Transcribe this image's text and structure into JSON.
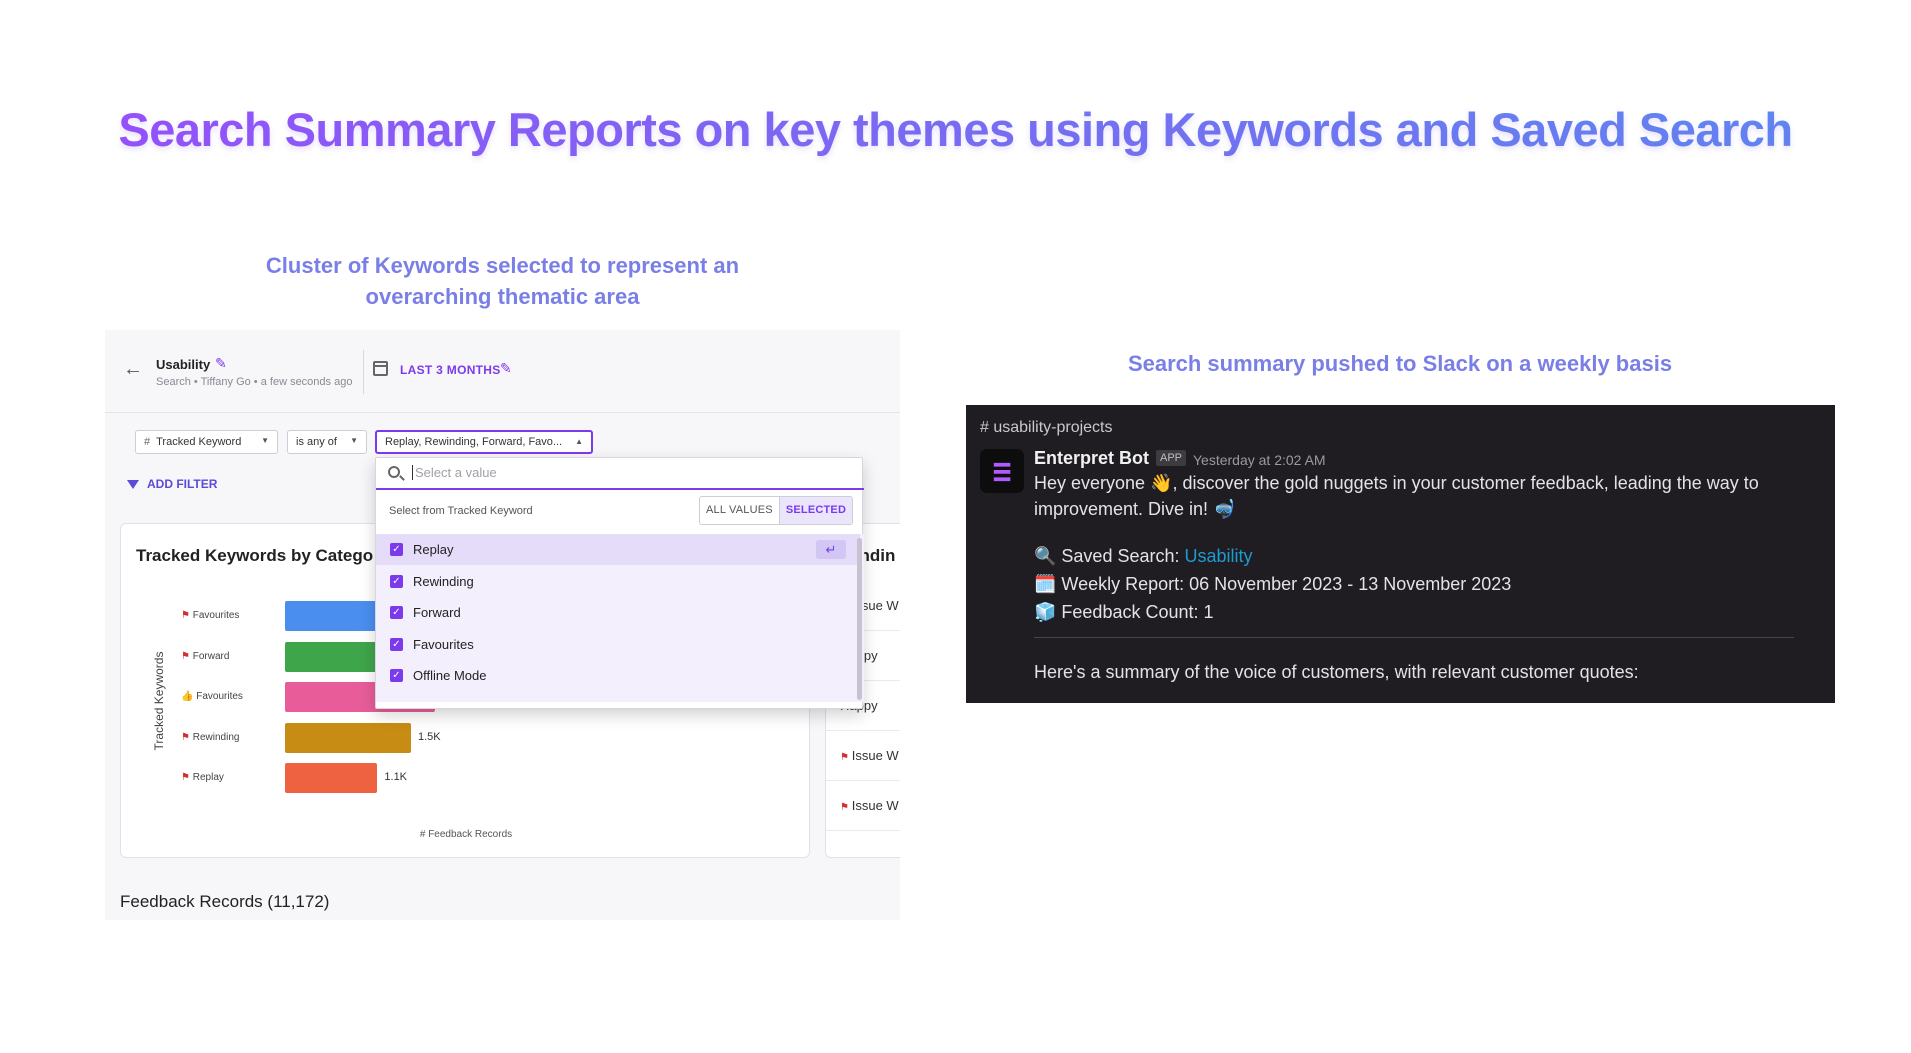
{
  "title": "Search Summary Reports on key themes using Keywords and Saved Search",
  "captions": {
    "left": "Cluster of Keywords selected to represent an overarching thematic area",
    "right": "Search summary pushed to Slack on a weekly basis"
  },
  "app": {
    "search_name": "Usability",
    "search_meta": "Search • Tiffany Go • a few seconds ago",
    "date_range": "LAST 3 MONTHS",
    "filters": {
      "field": "Tracked Keyword",
      "operator": "is any of",
      "values": "Replay, Rewinding, Forward, Favo...",
      "add_filter": "ADD FILTER"
    },
    "dropdown": {
      "placeholder": "Select a value",
      "from_label": "Select from Tracked Keyword",
      "toggle_all": "ALL VALUES",
      "toggle_selected": "SELECTED",
      "items": [
        "Replay",
        "Rewinding",
        "Forward",
        "Favourites",
        "Offline Mode"
      ]
    },
    "chart_title": "Tracked Keywords by Catego",
    "right_card_title": "endin",
    "right_card_rows": [
      "Issue W",
      "Happy",
      "Happy",
      "Issue W",
      "Issue W"
    ],
    "records_title": "Feedback Records (11,172)"
  },
  "chart_data": {
    "type": "bar",
    "orientation": "horizontal",
    "ylabel": "Tracked Keywords",
    "xlabel": "# Feedback Records",
    "categories": [
      "Favourites",
      "Forward",
      "Favourites",
      "Rewinding",
      "Replay"
    ],
    "category_icons": [
      "red-flag",
      "red-flag",
      "green-thumbs-up",
      "red-flag",
      "red-flag"
    ],
    "values": [
      null,
      null,
      null,
      1500,
      1100
    ],
    "value_labels": [
      "",
      "",
      "",
      "1.5K",
      "1.1K"
    ],
    "colors": [
      "#4a8ef0",
      "#3fa54b",
      "#e85d99",
      "#c78c13",
      "#ef6241"
    ],
    "note": "first three bars partially hidden behind dropdown"
  },
  "slack": {
    "channel": "# usability-projects",
    "bot_name": "Enterpret Bot",
    "badge": "APP",
    "time": "Yesterday at 2:02 AM",
    "line1": "Hey everyone 👋, discover the gold nuggets in your customer feedback, leading the way to",
    "line2": "improvement. Dive in! 🤿",
    "saved_search_prefix": "🔍 Saved Search: ",
    "saved_search_link": "Usability",
    "weekly_report": "🗓️ Weekly Report: 06 November 2023 - 13 November 2023",
    "feedback_count": "🧊 Feedback Count: 1",
    "summary": "Here's a summary of the voice of customers, with relevant customer quotes:"
  }
}
